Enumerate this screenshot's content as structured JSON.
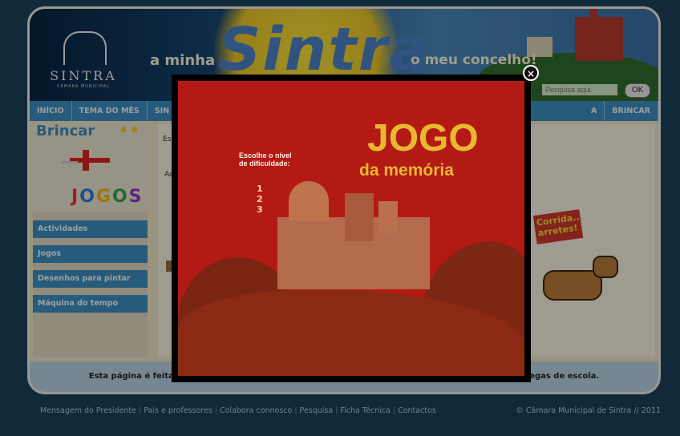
{
  "header": {
    "logo_name": "SINTRA",
    "logo_sub": "CÂMARA MUNICIPAL",
    "tagline_left": "a minha",
    "brand": "Sintra",
    "tagline_right": "o meu concelho!",
    "search_placeholder": "Pesquisa aqui.",
    "search_button": "OK"
  },
  "nav": {
    "items": [
      "INÍCIO",
      "TEMA DO MÊS",
      "SIN"
    ],
    "right_items": [
      "A",
      "BRINCAR"
    ]
  },
  "sidebar": {
    "title": "Brincar",
    "stars": "✸ ✸",
    "jogos_letters": [
      "J",
      "O",
      "G",
      "O",
      "S"
    ],
    "menu": [
      "Actividades",
      "Jogos",
      "Desenhos para pintar",
      "Máquina do tempo"
    ]
  },
  "content": {
    "text1": "Es",
    "text2": "Ac",
    "banner": "Corrida... arretes!"
  },
  "footer": {
    "message_left": "Esta página é feita",
    "message_right": "legas de escola."
  },
  "bottom": {
    "links": [
      "Mensagem do Presidente",
      "Pais e professores",
      "Colabora connosco",
      "Pesquisa",
      "Ficha Técnica",
      "Contactos"
    ],
    "copyright": "© Câmara Municipal de Sintra // 2011"
  },
  "modal": {
    "instruction_line1": "Escolhe o nível",
    "instruction_line2": "de dificuldade:",
    "levels": [
      "1",
      "2",
      "3"
    ],
    "title": "JOGO",
    "subtitle": "da memória",
    "close_symbol": "×"
  }
}
